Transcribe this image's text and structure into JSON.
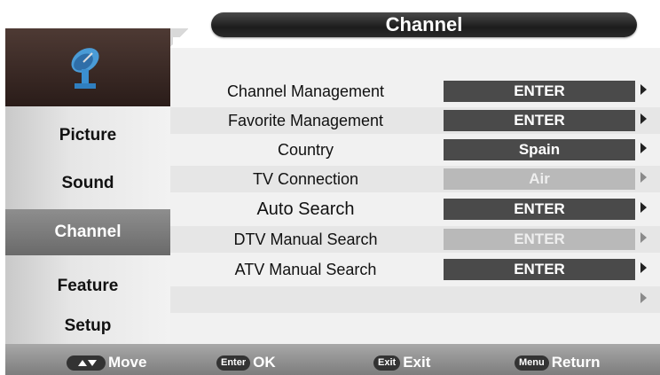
{
  "header": {
    "title": "Channel"
  },
  "sidebar": {
    "icon": "satellite-dish-icon",
    "items": [
      {
        "label": "Picture"
      },
      {
        "label": "Sound"
      },
      {
        "label": "Channel",
        "active": true
      },
      {
        "label": "Feature"
      },
      {
        "label": "Setup"
      }
    ]
  },
  "menu": {
    "rows": [
      {
        "label": "Channel Management",
        "value": "ENTER"
      },
      {
        "label": "Favorite Management",
        "value": "ENTER"
      },
      {
        "label": "Country",
        "value": "Spain"
      },
      {
        "label": "TV Connection",
        "value": "Air",
        "disabled": true
      },
      {
        "label": "Auto Search",
        "value": "ENTER"
      },
      {
        "label": "DTV Manual Search",
        "value": "ENTER",
        "disabled": true
      },
      {
        "label": "ATV Manual Search",
        "value": "ENTER"
      },
      {
        "label": "",
        "value": ""
      }
    ]
  },
  "footer": {
    "move": {
      "key": "up-down-keys",
      "label": "Move"
    },
    "ok": {
      "key": "Enter",
      "label": "OK"
    },
    "exit": {
      "key": "Exit",
      "label": "Exit"
    },
    "return": {
      "key": "Menu",
      "label": "Return"
    }
  },
  "colors": {
    "active_value_bg": "#4a4a4a",
    "disabled_value_bg": "#b9b9b9",
    "active_sidebar_bg": "#7a7a7a",
    "title_bg": "#1c1c1c"
  }
}
